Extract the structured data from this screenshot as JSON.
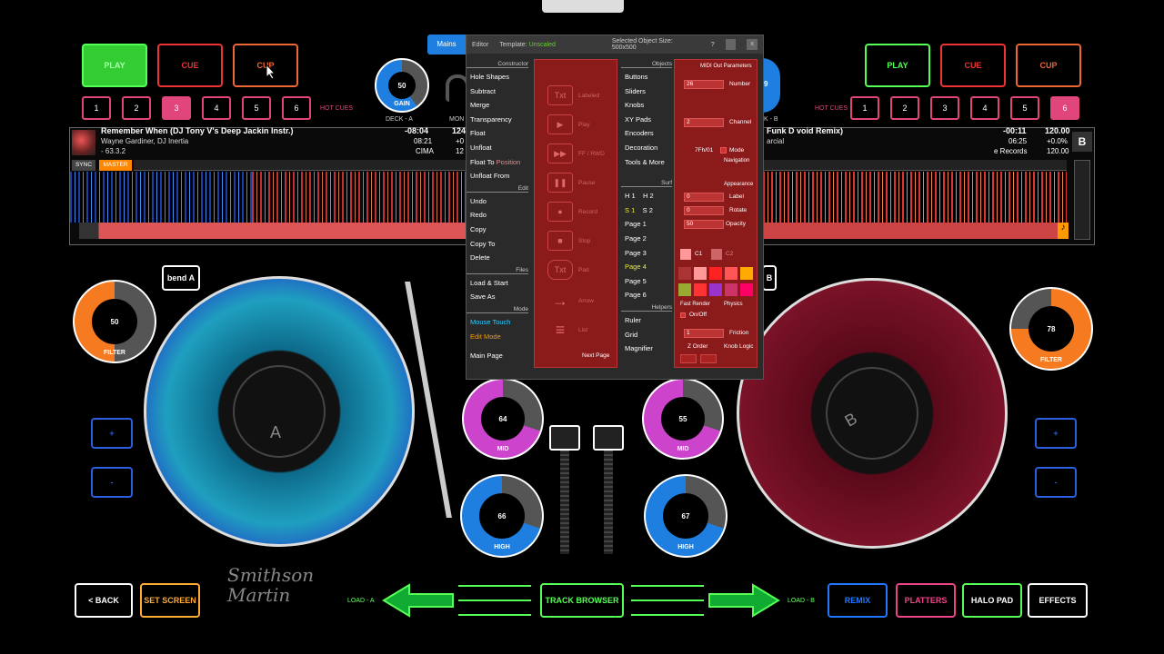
{
  "left_deck": {
    "play": "PLAY",
    "cue": "CUE",
    "cup": "CUP",
    "hot_cues": [
      "1",
      "2",
      "3",
      "4",
      "5",
      "6"
    ],
    "hot_cues_label": "HOT CUES",
    "gain": "50",
    "gain_label": "GAIN",
    "deck_label": "DECK - A",
    "mon_label": "MON",
    "bend": "bend A",
    "filter": "50",
    "filter_label": "FILTER",
    "platter_letter": "A",
    "plus": "+",
    "minus": "-",
    "track": {
      "title": "Remember When (DJ Tony V's Deep Jackin Instr.)",
      "artist": "Wayne Gardiner, DJ Inertia",
      "key": "- 63.3.2",
      "time_remaining": "-08:04",
      "time_elapsed": "08:21",
      "label": "CIMA",
      "bpm": "124",
      "bpm2": "+0",
      "bpm3": "12"
    },
    "sync": "SYNC",
    "master": "MASTER"
  },
  "right_deck": {
    "play": "PLAY",
    "cue": "CUE",
    "cup": "CUP",
    "hot_cues": [
      "1",
      "2",
      "3",
      "4",
      "5",
      "6"
    ],
    "hot_cues_label": "HOT CUES",
    "gain": "9",
    "deck_label": "K - B",
    "bend": "B",
    "filter": "78",
    "filter_label": "FILTER",
    "platter_letter": "B",
    "plus": "+",
    "minus": "-",
    "track": {
      "title": "Funk D void Remix)",
      "artist": "arcial",
      "time_remaining": "-00:11",
      "time_elapsed": "06:25",
      "label": "e Records",
      "bpm": "120.00",
      "pitch": "+0.0%",
      "bpm2": "120.00"
    },
    "deck_badge": "B"
  },
  "mixer": {
    "mid_a": "64",
    "mid_b": "55",
    "high_a": "66",
    "high_b": "67",
    "mid_label": "MID",
    "high_label": "HIGH"
  },
  "bottom": {
    "back": "< BACK",
    "set_screen": "SET SCREEN",
    "load_a": "LOAD - A",
    "load_b": "LOAD - B",
    "track_browser": "TRACK BROWSER",
    "remix": "REMIX",
    "platters": "PLATTERS",
    "halo_pad": "HALO PAD",
    "effects": "EFFECTS",
    "signature": "Smithson Martin"
  },
  "editor": {
    "mains": "Mains",
    "title": "Editor",
    "template_label": "Template:",
    "template_value": "Unscaled",
    "selected_size": "Selected Object Size: 500x500",
    "help": "?",
    "close": "x",
    "constructor_header": "Constructor",
    "constructor": [
      "Hole Shapes",
      "Subtract",
      "Merge",
      "Transparency",
      "Float",
      "Unfloat"
    ],
    "float_to": "Float To",
    "position": "Position",
    "unfloat_from": "Unfloat From",
    "edit_header": "Edit",
    "edit": [
      "Undo",
      "Redo",
      "Copy",
      "Copy To",
      "Delete"
    ],
    "files_header": "Files",
    "files": [
      "Load & Start",
      "Save As"
    ],
    "mode_header": "Mode",
    "mouse_touch": "Mouse Touch",
    "edit_mode": "Edit Mode",
    "main_page": "Main Page",
    "palette": [
      {
        "icon": "Txt",
        "label": "Labeled"
      },
      {
        "icon": "▶",
        "label": "Play"
      },
      {
        "icon": "▶▶",
        "label": "FF / RWD"
      },
      {
        "icon": "❚❚",
        "label": "Pause"
      },
      {
        "icon": "●",
        "label": "Record"
      },
      {
        "icon": "■",
        "label": "Stop"
      },
      {
        "icon": "Txt",
        "label": "Pad"
      },
      {
        "icon": "→",
        "label": "Arrow"
      },
      {
        "icon": "≡",
        "label": "List"
      }
    ],
    "next_page": "Next Page",
    "objects_header": "Objects",
    "objects": [
      "Buttons",
      "Sliders",
      "Knobs",
      "XY Pads",
      "Encoders",
      "Decoration",
      "Tools & More"
    ],
    "surf_header": "Surf",
    "h1": "H 1",
    "h2": "H 2",
    "s1": "S 1",
    "s2": "S 2",
    "pages": [
      "Page 1",
      "Page 2",
      "Page 3",
      "Page 4",
      "Page 5",
      "Page 6"
    ],
    "helpers_header": "Helpers",
    "helpers": [
      "Ruler",
      "Grid",
      "Magnifier"
    ],
    "midi_header": "MIDI Out Parameters",
    "number_val": "26",
    "number_label": "Number",
    "channel_val": "2",
    "channel_label": "Channel",
    "midi_code": "7Fh/01",
    "mode_label": "Mode",
    "navigation": "Navigation",
    "appearance": "Appearance",
    "label_val": "0",
    "label_label": "Label",
    "rotate_val": "0",
    "rotate_label": "Rotate",
    "opacity_val": "50",
    "opacity_label": "Opacity",
    "c1": "C1",
    "c2": "C2",
    "fast_render": "Fast Render",
    "physics": "Physics",
    "onoff": "On/Off",
    "friction_val": "1",
    "friction_label": "Friction",
    "z_order": "Z Order",
    "knob_logic": "Knob Logic",
    "swatches": [
      "#a33",
      "#f99",
      "#f22",
      "#f55",
      "#f80",
      "#fa0",
      "#9a3",
      "#f33",
      "#93c",
      "#c3c",
      "#c36",
      "#f06"
    ]
  }
}
